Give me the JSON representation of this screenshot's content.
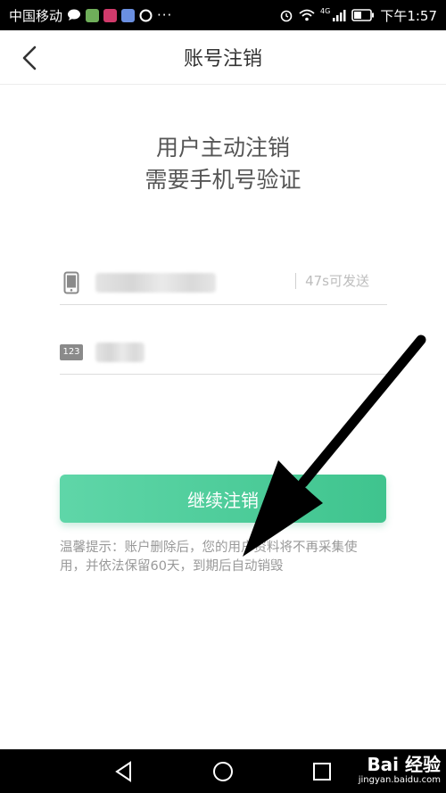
{
  "status_bar": {
    "carrier": "中国移动",
    "network": "4G",
    "time": "下午1:57"
  },
  "header": {
    "title": "账号注销"
  },
  "main": {
    "headline_line1": "用户主动注销",
    "headline_line2": "需要手机号验证",
    "phone_field": {
      "resend_label": "47s可发送"
    },
    "code_field": {
      "icon_text": "123"
    },
    "continue_button_label": "继续注销",
    "tip_text": "温馨提示：账户删除后，您的用户资料将不再采集使用，并依法保留60天，到期后自动销毁"
  },
  "watermark": {
    "text": "Bai 经验",
    "domain": "jingyan.baidu.com"
  },
  "colors": {
    "accent": "#45c993",
    "status_bar_bg": "#000000"
  }
}
